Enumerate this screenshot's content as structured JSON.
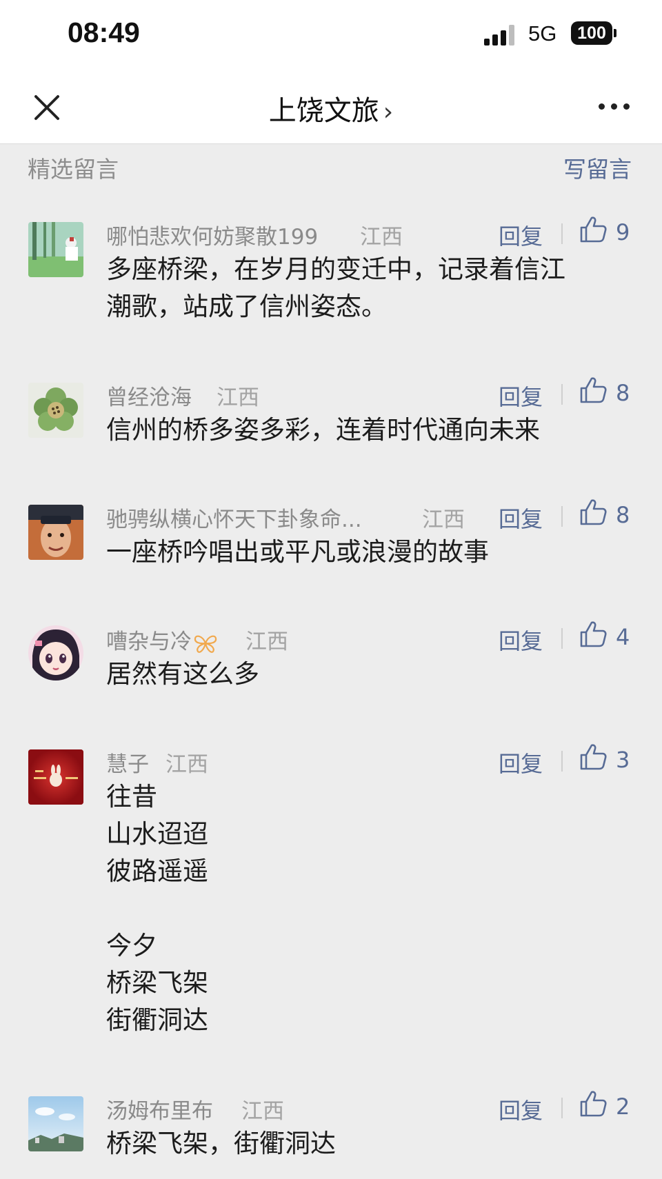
{
  "status_bar": {
    "time": "08:49",
    "network": "5G",
    "battery": "100",
    "icons": [
      "signal-icon",
      "battery-icon"
    ]
  },
  "nav": {
    "title": "上饶文旅",
    "chevron": "›",
    "icons": [
      "close-icon",
      "chevron-right-icon",
      "more-icon"
    ]
  },
  "section": {
    "title": "精选留言",
    "write_label": "写留言"
  },
  "reply_label": "回复",
  "colors": {
    "link": "#576b95",
    "background": "#ededed",
    "text": "#1c1c1c",
    "meta": "#8a8a8a"
  },
  "comments": [
    {
      "username": "哪怕悲欢何妨聚散199",
      "region": "江西",
      "likes": "9",
      "text": "多座桥梁，在岁月的变迁中，记录着信江\n潮歌，站成了信州姿态。",
      "avatar": "forest-avatar"
    },
    {
      "username": "曾经沧海",
      "region": "江西",
      "likes": "8",
      "text": "信州的桥多姿多彩，连着时代通向未来",
      "avatar": "flower-avatar"
    },
    {
      "username": "驰骋纵横心怀天下卦象命...",
      "region": "江西",
      "likes": "8",
      "text": "一座桥吟唱出或平凡或浪漫的故事",
      "avatar": "man-avatar"
    },
    {
      "username": "嘈杂与冷",
      "region": "江西",
      "likes": "4",
      "text": "居然有这么多",
      "avatar": "anime-girl-avatar",
      "badge": "butterfly-icon"
    },
    {
      "username": "慧子",
      "region": "江西",
      "likes": "3",
      "text": "往昔\n山水迢迢\n彼路遥遥\n\n今夕\n桥梁飞架\n街衢洞达",
      "avatar": "red-rabbit-avatar"
    },
    {
      "username": "汤姆布里布",
      "region": "江西",
      "likes": "2",
      "text": "桥梁飞架，街衢洞达",
      "avatar": "sky-avatar"
    }
  ]
}
